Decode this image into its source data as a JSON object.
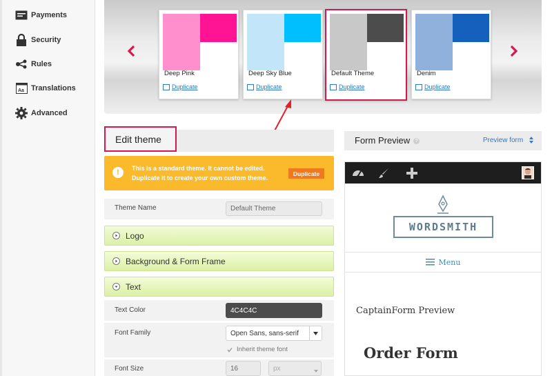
{
  "sidebar": {
    "items": [
      {
        "label": "Payments",
        "icon": "payments-icon"
      },
      {
        "label": "Security",
        "icon": "lock-icon"
      },
      {
        "label": "Rules",
        "icon": "rules-icon"
      },
      {
        "label": "Translations",
        "icon": "translations-icon"
      },
      {
        "label": "Advanced",
        "icon": "gear-icon"
      }
    ]
  },
  "carousel": {
    "prev_icon": "chevron-left-icon",
    "next_icon": "chevron-right-icon",
    "themes": [
      {
        "name": "Deep Pink",
        "duplicate_label": "Duplicate",
        "colors": {
          "main": "#ff90cd",
          "accent": "#ff1493"
        },
        "selected": false
      },
      {
        "name": "Deep Sky Blue",
        "duplicate_label": "Duplicate",
        "colors": {
          "main": "#c2e5fa",
          "accent": "#00bfff"
        },
        "selected": false
      },
      {
        "name": "Default Theme",
        "duplicate_label": "Duplicate",
        "colors": {
          "main": "#c8c8c8",
          "accent": "#4c4c4c"
        },
        "selected": true
      },
      {
        "name": "Denim",
        "duplicate_label": "Duplicate",
        "colors": {
          "main": "#8fb1dc",
          "accent": "#1560bd"
        },
        "selected": false
      }
    ]
  },
  "edit_theme": {
    "title": "Edit theme",
    "notice": {
      "line1": "This is a standard theme. It cannot be edited.",
      "line2": "Duplicate it to create your own custom theme.",
      "button": "Duplicate"
    },
    "theme_name_label": "Theme Name",
    "theme_name_value": "Default Theme",
    "sections": {
      "logo": "Logo",
      "background": "Background & Form Frame",
      "text": "Text"
    },
    "text_color_label": "Text Color",
    "text_color_value": "4C4C4C",
    "font_family_label": "Font Family",
    "font_family_value": "Open Sans, sans-serif",
    "inherit_label": "Inherit theme font",
    "font_size_label": "Font Size",
    "font_size_value": "16",
    "font_size_unit": "px"
  },
  "preview": {
    "title": "Form Preview",
    "help": "?",
    "link": "Preview form",
    "logo_text": "WORDSMITH",
    "menu_label": "Menu",
    "caption": "CaptainForm Preview",
    "form_title": "Order Form"
  },
  "colors": {
    "accent_pink": "#d8174f",
    "notice_bg": "#fbb92c",
    "link_blue": "#2e78c8"
  }
}
